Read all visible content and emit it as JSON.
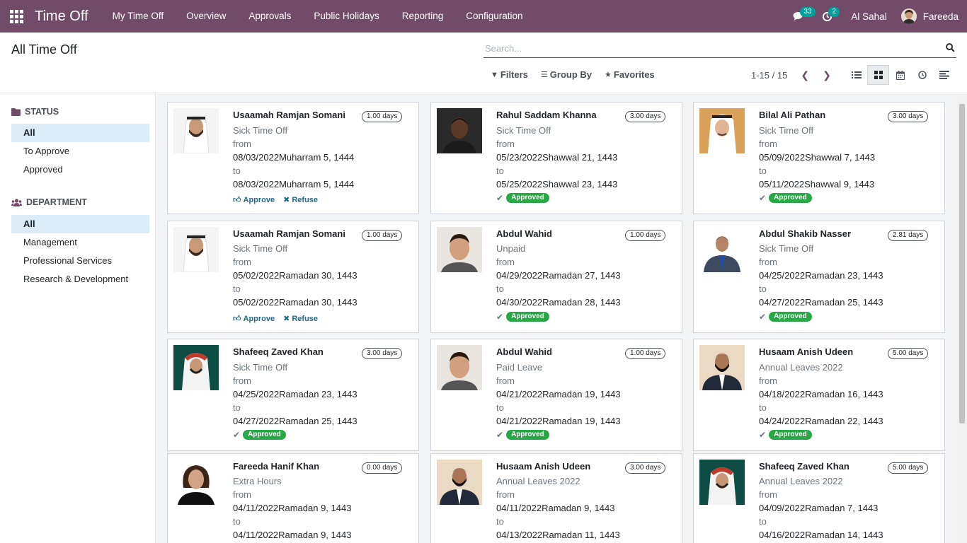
{
  "app": {
    "title": "Time Off"
  },
  "menu": [
    "My Time Off",
    "Overview",
    "Approvals",
    "Public Holidays",
    "Reporting",
    "Configuration"
  ],
  "nav": {
    "messages_count": "33",
    "activities_count": "2",
    "company": "Al Sahal",
    "user": "Fareeda"
  },
  "page": {
    "title": "All Time Off"
  },
  "search": {
    "placeholder": "Search..."
  },
  "filters": {
    "filters_label": "Filters",
    "groupby_label": "Group By",
    "favorites_label": "Favorites"
  },
  "pager": {
    "range": "1-15 / 15"
  },
  "sidebar": {
    "status_title": "Status",
    "status_items": [
      "All",
      "To Approve",
      "Approved"
    ],
    "department_title": "Department",
    "department_items": [
      "All",
      "Management",
      "Professional Services",
      "Research & Development"
    ]
  },
  "labels": {
    "from": "from",
    "to": "to",
    "approve": "Approve",
    "refuse": "Refuse",
    "approved": "Approved"
  },
  "cards": [
    {
      "employee": "Usaamah Ramjan Somani",
      "days": "1.00 days",
      "type": "Sick Time Off",
      "from_date": "08/03/2022Muharram 5, 1444",
      "to_date": "08/03/2022Muharram 5, 1444",
      "state": "to_approve"
    },
    {
      "employee": "Rahul Saddam Khanna",
      "days": "3.00 days",
      "type": "Sick Time Off",
      "from_date": "05/23/2022Shawwal 21, 1443",
      "to_date": "05/25/2022Shawwal 23, 1443",
      "state": "approved"
    },
    {
      "employee": "Bilal Ali Pathan",
      "days": "3.00 days",
      "type": "Sick Time Off",
      "from_date": "05/09/2022Shawwal 7, 1443",
      "to_date": "05/11/2022Shawwal 9, 1443",
      "state": "approved"
    },
    {
      "employee": "Usaamah Ramjan Somani",
      "days": "1.00 days",
      "type": "Sick Time Off",
      "from_date": "05/02/2022Ramadan 30, 1443",
      "to_date": "05/02/2022Ramadan 30, 1443",
      "state": "to_approve"
    },
    {
      "employee": "Abdul Wahid",
      "days": "1.00 days",
      "type": "Unpaid",
      "from_date": "04/29/2022Ramadan 27, 1443",
      "to_date": "04/30/2022Ramadan 28, 1443",
      "state": "approved"
    },
    {
      "employee": "Abdul Shakib Nasser",
      "days": "2.81 days",
      "type": "Sick Time Off",
      "from_date": "04/25/2022Ramadan 23, 1443",
      "to_date": "04/27/2022Ramadan 25, 1443",
      "state": "approved"
    },
    {
      "employee": "Shafeeq Zaved Khan",
      "days": "3.00 days",
      "type": "Sick Time Off",
      "from_date": "04/25/2022Ramadan 23, 1443",
      "to_date": "04/27/2022Ramadan 25, 1443",
      "state": "approved"
    },
    {
      "employee": "Abdul Wahid",
      "days": "1.00 days",
      "type": "Paid Leave",
      "from_date": "04/21/2022Ramadan 19, 1443",
      "to_date": "04/21/2022Ramadan 19, 1443",
      "state": "approved"
    },
    {
      "employee": "Husaam Anish Udeen",
      "days": "5.00 days",
      "type": "Annual Leaves 2022",
      "from_date": "04/18/2022Ramadan 16, 1443",
      "to_date": "04/24/2022Ramadan 22, 1443",
      "state": "approved"
    },
    {
      "employee": "Fareeda Hanif Khan",
      "days": "0.00 days",
      "type": "Extra Hours",
      "from_date": "04/11/2022Ramadan 9, 1443",
      "to_date": "04/11/2022Ramadan 9, 1443",
      "state": "approved"
    },
    {
      "employee": "Husaam Anish Udeen",
      "days": "3.00 days",
      "type": "Annual Leaves 2022",
      "from_date": "04/11/2022Ramadan 9, 1443",
      "to_date": "04/13/2022Ramadan 11, 1443",
      "state": "approved"
    },
    {
      "employee": "Shafeeq Zaved Khan",
      "days": "5.00 days",
      "type": "Annual Leaves 2022",
      "from_date": "04/09/2022Ramadan 7, 1443",
      "to_date": "04/16/2022Ramadan 14, 1443",
      "state": "approved"
    }
  ]
}
